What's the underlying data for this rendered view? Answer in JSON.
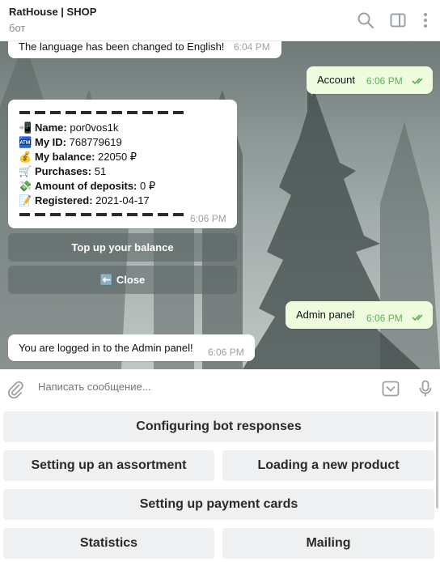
{
  "header": {
    "title": "RatHouse | SHOP",
    "subtitle": "бот",
    "icons": [
      "search-icon",
      "sidebar-toggle-icon",
      "more-vertical-icon"
    ]
  },
  "messages": {
    "language_notice": {
      "text": "The language has been changed to English!",
      "time": "6:04 PM"
    },
    "account": {
      "text": "Account",
      "time": "6:06 PM",
      "status": "read"
    },
    "profile_card": {
      "time": "6:06 PM",
      "rows": [
        {
          "emoji": "📲",
          "label": "Name:",
          "value": "por0vos1k"
        },
        {
          "emoji": "🏧",
          "label": "My ID:",
          "value": "768779619"
        },
        {
          "emoji": "💰",
          "label": "My balance:",
          "value": "22050 ₽"
        },
        {
          "emoji": "🛒",
          "label": "Purchases:",
          "value": "51"
        },
        {
          "emoji": "💸",
          "label": "Amount of deposits:",
          "value": "0 ₽"
        },
        {
          "emoji": "📝",
          "label": "Registered:",
          "value": "2021-04-17"
        }
      ],
      "buttons": {
        "top_up": "Top up your balance",
        "close_emoji": "⬅️",
        "close": "Close"
      }
    },
    "admin_panel": {
      "text": "Admin panel",
      "time": "6:06 PM",
      "status": "read"
    },
    "admin_logged": {
      "text": "You are logged in to the Admin panel!",
      "time": "6:06 PM"
    }
  },
  "input": {
    "placeholder": "Написать сообщение...",
    "icons": [
      "attach-icon",
      "keyboard-toggle-icon",
      "microphone-icon"
    ]
  },
  "keyboard": {
    "configuring": "Configuring bot responses",
    "assortment": "Setting up an assortment",
    "loading": "Loading a new product",
    "payment_cards": "Setting up payment cards",
    "statistics": "Statistics",
    "mailing": "Mailing"
  },
  "colors": {
    "outgoing_bubble": "#effdde",
    "read_ticks": "#5fb15a",
    "keyboard_button": "#eef0f2"
  }
}
